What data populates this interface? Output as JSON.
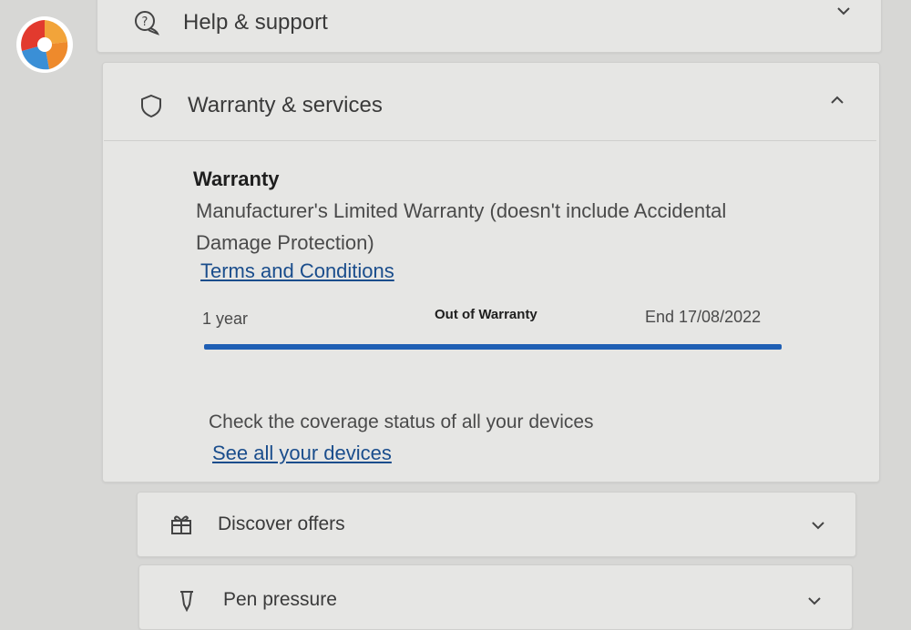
{
  "menu": {
    "help": {
      "label": "Help & support",
      "icon": "help-icon"
    },
    "warranty": {
      "label": "Warranty & services",
      "icon": "shield-icon",
      "expanded": true
    },
    "offers": {
      "label": "Discover offers",
      "icon": "gift-icon"
    },
    "pen": {
      "label": "Pen pressure",
      "icon": "pen-icon"
    }
  },
  "warranty": {
    "title": "Warranty",
    "description": "Manufacturer's Limited Warranty (doesn't include Accidental Damage Protection)",
    "terms_link": "Terms and Conditions",
    "duration": "1 year",
    "status": "Out of Warranty",
    "end": "End 17/08/2022",
    "progress": 1.0,
    "coverage_text": "Check the coverage status of all your devices",
    "devices_link": "See all your devices"
  },
  "colors": {
    "accent": "#1f5fb4",
    "link": "#1a4d8c"
  }
}
